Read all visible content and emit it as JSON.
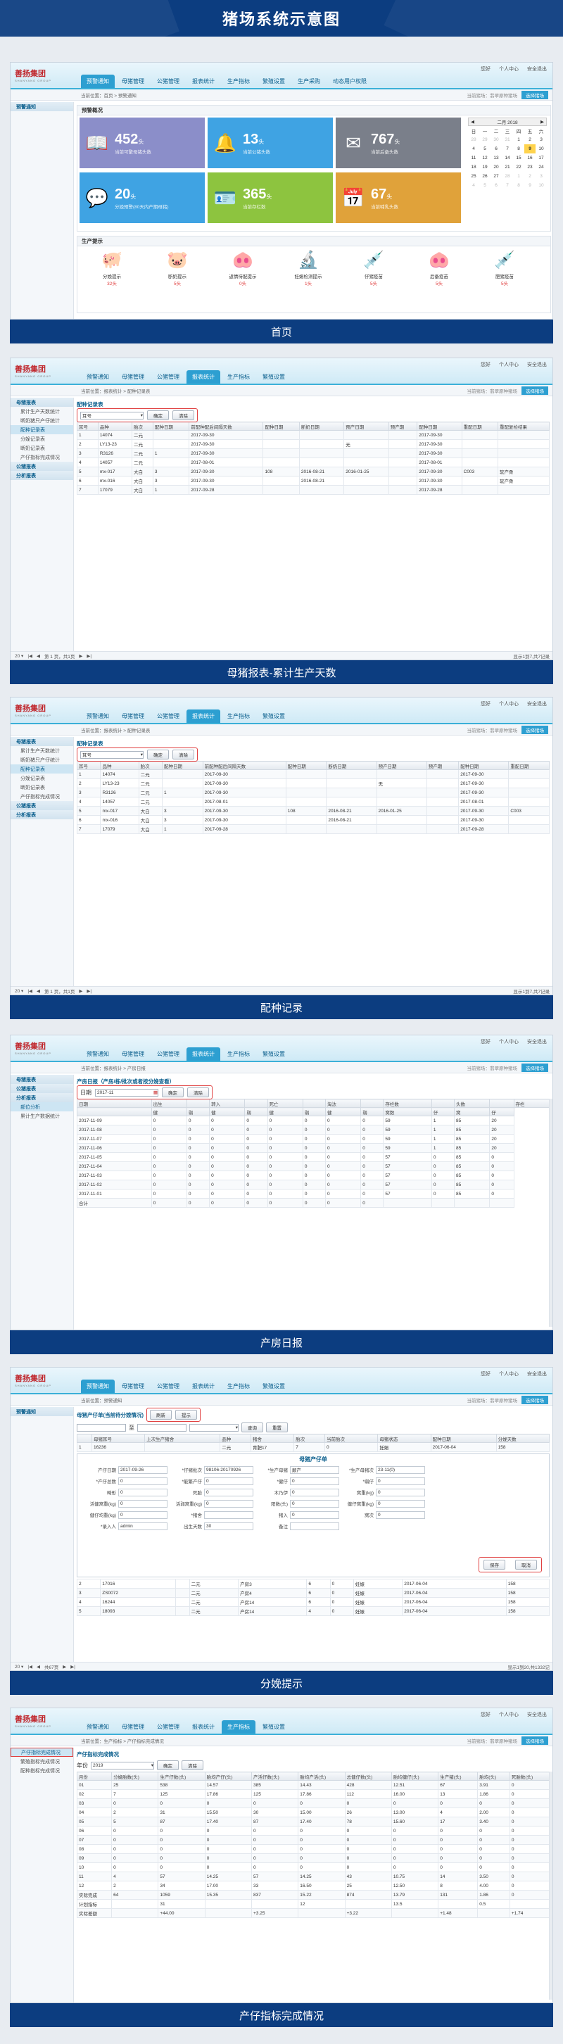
{
  "banner_title": "猪场系统示意图",
  "app": {
    "logo": "善扬集团",
    "logo_sub": "SHANYANG GROUP",
    "user": "您好",
    "user2": "个人中心",
    "logout": "安全退出",
    "farm": "当前猪场：",
    "farm_name": "翡翠原种猪场",
    "switch": "选择猪场"
  },
  "s1": {
    "caption": "首页",
    "tabs": [
      "预警通知",
      "母猪管理",
      "公猪管理",
      "报表统计",
      "生产指标",
      "繁殖设置",
      "生产采购",
      "动态用户权限"
    ],
    "crumb": "当前位置：首页 > 预警通知",
    "side_title": "预警通知",
    "panel_title": "预警概况",
    "cards": [
      {
        "num": "452",
        "unit": "头",
        "label": "当前可繁母猪头数",
        "color": "#8b8ec9",
        "icon": "📖"
      },
      {
        "num": "13",
        "unit": "头",
        "label": "当前公猪头数",
        "color": "#3fa3e3",
        "icon": "🔔"
      },
      {
        "num": "767",
        "unit": "头",
        "label": "当前后备头数",
        "color": "#7a7f8a",
        "icon": "✉"
      },
      {
        "num": "20",
        "unit": "头",
        "label": "分娩预警(80天内产期母猪)",
        "color": "#3fa3e3",
        "icon": "💬"
      },
      {
        "num": "365",
        "unit": "头",
        "label": "当前存栏数",
        "color": "#8dc43f",
        "icon": "🪪"
      },
      {
        "num": "67",
        "unit": "头",
        "label": "当前哺乳头数",
        "color": "#e0a23a",
        "icon": "📅"
      }
    ],
    "cal_title": "二月 2018",
    "cal_days": [
      "日",
      "一",
      "二",
      "三",
      "四",
      "五",
      "六"
    ],
    "cal_rows": [
      [
        "28",
        "29",
        "30",
        "31",
        "1",
        "2",
        "3"
      ],
      [
        "4",
        "5",
        "6",
        "7",
        "8",
        "9",
        "10"
      ],
      [
        "11",
        "12",
        "13",
        "14",
        "15",
        "16",
        "17"
      ],
      [
        "18",
        "19",
        "20",
        "21",
        "22",
        "23",
        "24"
      ],
      [
        "25",
        "26",
        "27",
        "28",
        "1",
        "2",
        "3"
      ],
      [
        "4",
        "5",
        "6",
        "7",
        "8",
        "9",
        "10"
      ]
    ],
    "tips_title": "生产提示",
    "tips": [
      {
        "icon": "🐖",
        "name": "分娩提示",
        "count": "32头"
      },
      {
        "icon": "🐷",
        "name": "断奶提示",
        "count": "5头"
      },
      {
        "icon": "🐽",
        "name": "返情待配提示",
        "count": "0头"
      },
      {
        "icon": "🔬",
        "name": "妊娠检测提示",
        "count": "1头"
      },
      {
        "icon": "💉",
        "name": "仔猪疫苗",
        "count": "5头"
      },
      {
        "icon": "🐽",
        "name": "后备疫苗",
        "count": "5头"
      },
      {
        "icon": "💉",
        "name": "肥猪疫苗",
        "count": "5头"
      }
    ]
  },
  "s2": {
    "caption": "母猪报表-累计生产天数",
    "tabs": [
      "预警通知",
      "母猪管理",
      "公猪管理",
      "报表统计",
      "生产指标",
      "繁殖设置"
    ],
    "crumb": "当前位置：报表统计 > 配种记录表",
    "side": [
      "母猪报表",
      "累计生产天数统计",
      "断奶猪只产仔统计",
      "配种记录表",
      "分娩记录表",
      "断奶记录表",
      "产仔指标完成情况",
      "公猪报表",
      "分析报表"
    ],
    "table_title": "配种记录表",
    "sel": "耳号",
    "btn1": "确定",
    "btn2": "清除",
    "cols": [
      "耳号",
      "品种",
      "胎次",
      "配种日期",
      "前配种配后间隔天数",
      "配种日期",
      "断奶日期",
      "预产日期",
      "预产期",
      "配种日期",
      "重配日期",
      "重配复检结果"
    ],
    "rows": [
      [
        "1",
        "14074",
        "二元",
        "",
        "2017-09-30",
        "",
        "",
        "",
        "",
        "2017-09-30",
        "",
        ""
      ],
      [
        "2",
        "LY13-23",
        "二元",
        "",
        "2017-09-30",
        "",
        "",
        "无",
        "",
        "2017-09-30",
        "",
        ""
      ],
      [
        "3",
        "R3126",
        "二元",
        "1",
        "2017-09-30",
        "",
        "",
        "",
        "",
        "2017-09-30",
        "",
        ""
      ],
      [
        "4",
        "14057",
        "二元",
        "",
        "2017-08-01",
        "",
        "",
        "",
        "",
        "2017-08-01",
        "",
        ""
      ],
      [
        "5",
        "mx-017",
        "大白",
        "3",
        "2017-09-30",
        "108",
        "2016-08-21",
        "2016-01-25",
        "",
        "2017-09-30",
        "C003",
        "软产骨"
      ],
      [
        "6",
        "mx-016",
        "大白",
        "3",
        "2017-09-30",
        "",
        "2016-08-21",
        "",
        "",
        "2017-09-30",
        "",
        "软产骨"
      ],
      [
        "7",
        "17079",
        "大白",
        "1",
        "2017-09-28",
        "",
        "",
        "",
        "",
        "2017-09-28",
        "",
        ""
      ]
    ],
    "pager": "第 1 页，共1页",
    "pager_r": "显示1到7,共7记录"
  },
  "s3": {
    "caption": "配种记录",
    "crumb": "当前位置：报表统计 > 配种记录表",
    "table_title": "配种记录表",
    "cols": [
      "耳号",
      "品种",
      "胎次",
      "配种日期",
      "前配种配后间隔天数",
      "配种日期",
      "断奶日期",
      "预产日期",
      "预产期",
      "配种日期",
      "重配日期"
    ],
    "rows": [
      [
        "1",
        "14074",
        "二元",
        "",
        "2017-09-30",
        "",
        "",
        "",
        "",
        "2017-09-30",
        ""
      ],
      [
        "2",
        "LY13-23",
        "二元",
        "",
        "2017-09-30",
        "",
        "",
        "无",
        "",
        "2017-09-30",
        ""
      ],
      [
        "3",
        "R3126",
        "二元",
        "1",
        "2017-09-30",
        "",
        "",
        "",
        "",
        "2017-09-30",
        ""
      ],
      [
        "4",
        "14057",
        "二元",
        "",
        "2017-08-01",
        "",
        "",
        "",
        "",
        "2017-08-01",
        ""
      ],
      [
        "5",
        "mx-017",
        "大白",
        "3",
        "2017-09-30",
        "108",
        "2016-08-21",
        "2016-01-25",
        "",
        "2017-09-30",
        "C003"
      ],
      [
        "6",
        "mx-016",
        "大白",
        "3",
        "2017-09-30",
        "",
        "2016-08-21",
        "",
        "",
        "2017-09-30",
        ""
      ],
      [
        "7",
        "17079",
        "大白",
        "1",
        "2017-09-28",
        "",
        "",
        "",
        "",
        "2017-09-28",
        ""
      ]
    ],
    "pager_r": "显示1到7,共7记录"
  },
  "s4": {
    "caption": "产房日报",
    "crumb": "当前位置：报表统计 > 产房日报",
    "side": [
      "母猪报表",
      "公猪报表",
      "分析报表",
      "部位分析",
      "累计生产数据统计"
    ],
    "table_title": "产房日报（产房/栋/批次或者按分娩查看）",
    "date_lbl": "日期",
    "date": "2017-11",
    "cols": [
      "日期",
      "出生",
      "",
      "转入",
      "",
      "死亡",
      "",
      "淘汰",
      "",
      "存栏数",
      "",
      "头数",
      "",
      "存栏"
    ],
    "sub": [
      "",
      "健",
      "弱",
      "健",
      "弱",
      "健",
      "弱",
      "健",
      "弱",
      "窝数",
      "仔",
      "窝",
      "仔"
    ],
    "rows": [
      [
        "2017-11-09",
        "0",
        "0",
        "0",
        "0",
        "0",
        "0",
        "0",
        "0",
        "59",
        "1",
        "85",
        "20"
      ],
      [
        "2017-11-08",
        "0",
        "0",
        "0",
        "0",
        "0",
        "0",
        "0",
        "0",
        "59",
        "1",
        "85",
        "20"
      ],
      [
        "2017-11-07",
        "0",
        "0",
        "0",
        "0",
        "0",
        "0",
        "0",
        "0",
        "59",
        "1",
        "85",
        "20"
      ],
      [
        "2017-11-06",
        "0",
        "0",
        "0",
        "0",
        "0",
        "0",
        "0",
        "0",
        "59",
        "1",
        "85",
        "20"
      ],
      [
        "2017-11-05",
        "0",
        "0",
        "0",
        "0",
        "0",
        "0",
        "0",
        "0",
        "57",
        "0",
        "85",
        "0"
      ],
      [
        "2017-11-04",
        "0",
        "0",
        "0",
        "0",
        "0",
        "0",
        "0",
        "0",
        "57",
        "0",
        "85",
        "0"
      ],
      [
        "2017-11-03",
        "0",
        "0",
        "0",
        "0",
        "0",
        "0",
        "0",
        "0",
        "57",
        "0",
        "85",
        "0"
      ],
      [
        "2017-11-02",
        "0",
        "0",
        "0",
        "0",
        "0",
        "0",
        "0",
        "0",
        "57",
        "0",
        "85",
        "0"
      ],
      [
        "2017-11-01",
        "0",
        "0",
        "0",
        "0",
        "0",
        "0",
        "0",
        "0",
        "57",
        "0",
        "85",
        "0"
      ],
      [
        "合计",
        "0",
        "0",
        "0",
        "0",
        "0",
        "0",
        "0",
        "0",
        "",
        "",
        "",
        ""
      ]
    ]
  },
  "s5": {
    "caption": "分娩提示",
    "crumb": "当前位置：预警通知",
    "side_title": "预警通知",
    "table_title": "母猪产仔单(当前待分娩情况)",
    "b1": "刷新",
    "b2": "提示",
    "form_title": "母猪产仔单",
    "form": [
      [
        "产仔日期",
        "2017-09-26",
        "*仔猪批次",
        "98106-20170926",
        "*生产母猪",
        "颠产",
        "*生产母猪次",
        "23-11(0)"
      ],
      [
        "*产仔总数",
        "0",
        "*能繁产仔",
        "0",
        "*健仔",
        "0",
        "*弱仔",
        "0"
      ],
      [
        "畸形",
        "0",
        "死胎",
        "0",
        "木乃伊",
        "0",
        "窝重(kg)",
        "0"
      ],
      [
        "活健窝重(kg)",
        "0",
        "活弱窝重(kg)",
        "0",
        "阳数(头)",
        "0",
        "健仔窝重(kg)",
        "0"
      ],
      [
        "健仔均重(kg)",
        "0",
        "*猪舍",
        "",
        "猪入",
        "0",
        "窝次",
        "0"
      ],
      [
        "*录入人",
        "admin",
        "出生天数",
        "30",
        "备注",
        "",
        "",
        ""
      ]
    ],
    "save": "保存",
    "cancel": "取消",
    "cols": [
      "",
      "母猪耳号",
      "上次生产猪舍",
      "品种",
      "猪舍",
      "胎次",
      "当前胎次",
      "母猪状态",
      "配种日期",
      "分娩天数"
    ],
    "rows": [
      [
        "1",
        "16236",
        "",
        "二元",
        "育肥17",
        "7",
        "0",
        "妊娠",
        "2017-06-04",
        "158"
      ],
      [
        "2",
        "17016",
        "",
        "二元",
        "产房3",
        "6",
        "0",
        "妊娠",
        "2017-06-04",
        "158"
      ],
      [
        "3",
        "ZS0072",
        "",
        "二元",
        "产房4",
        "6",
        "0",
        "妊娠",
        "2017-06-04",
        "158"
      ],
      [
        "4",
        "16244",
        "",
        "二元",
        "产房14",
        "6",
        "0",
        "妊娠",
        "2017-06-04",
        "158"
      ],
      [
        "5",
        "18093",
        "",
        "二元",
        "产房14",
        "4",
        "0",
        "妊娠",
        "2017-06-04",
        "158"
      ]
    ],
    "pager_r": "显示1到20,共1332记"
  },
  "s6": {
    "caption": "产仔指标完成情况",
    "crumb": "当前位置：生产指标 > 产仔指标完成情况",
    "side": [
      "产仔指标完成情况",
      "繁殖指标完成情况",
      "配种指标完成情况"
    ],
    "table_title": "产仔指标完成情况",
    "year_lbl": "年份",
    "year": "2019",
    "cols": [
      "月份",
      "分娩胎数(头)",
      "生产仔数(头)",
      "胎均产仔(头)",
      "产活仔数(头)",
      "胎均产活(头)",
      "总健仔数(头)",
      "胎均健仔(头)",
      "生产猪(头)",
      "胎均(头)",
      "死胎数(头)"
    ],
    "rows": [
      [
        "01",
        "25",
        "538",
        "14.57",
        "385",
        "14.43",
        "428",
        "12.51",
        "67",
        "3.91",
        "0"
      ],
      [
        "02",
        "7",
        "125",
        "17.86",
        "125",
        "17.86",
        "112",
        "16.00",
        "13",
        "1.86",
        "0"
      ],
      [
        "03",
        "0",
        "0",
        "0",
        "0",
        "0",
        "0",
        "0",
        "0",
        "0",
        "0"
      ],
      [
        "04",
        "2",
        "31",
        "15.50",
        "30",
        "15.00",
        "26",
        "13.00",
        "4",
        "2.00",
        "0"
      ],
      [
        "05",
        "5",
        "87",
        "17.40",
        "87",
        "17.40",
        "78",
        "15.60",
        "17",
        "3.40",
        "0"
      ],
      [
        "06",
        "0",
        "0",
        "0",
        "0",
        "0",
        "0",
        "0",
        "0",
        "0",
        "0"
      ],
      [
        "07",
        "0",
        "0",
        "0",
        "0",
        "0",
        "0",
        "0",
        "0",
        "0",
        "0"
      ],
      [
        "08",
        "0",
        "0",
        "0",
        "0",
        "0",
        "0",
        "0",
        "0",
        "0",
        "0"
      ],
      [
        "09",
        "0",
        "0",
        "0",
        "0",
        "0",
        "0",
        "0",
        "0",
        "0",
        "0"
      ],
      [
        "10",
        "0",
        "0",
        "0",
        "0",
        "0",
        "0",
        "0",
        "0",
        "0",
        "0"
      ],
      [
        "11",
        "4",
        "57",
        "14.25",
        "57",
        "14.25",
        "43",
        "10.75",
        "14",
        "3.50",
        "0"
      ],
      [
        "12",
        "2",
        "34",
        "17.00",
        "33",
        "16.50",
        "25",
        "12.50",
        "8",
        "4.00",
        "0"
      ],
      [
        "实际完成",
        "64",
        "1059",
        "15.35",
        "837",
        "15.22",
        "874",
        "13.79",
        "131",
        "1.86",
        "0"
      ],
      [
        "计划指标",
        "",
        "31",
        "",
        "",
        "12",
        "",
        "13.5",
        "",
        "0.5",
        ""
      ],
      [
        "实际差额",
        "",
        "+44.00",
        "",
        "+3.25",
        "",
        "+3.22",
        "",
        "+1.48",
        "",
        "+1.74"
      ]
    ]
  }
}
